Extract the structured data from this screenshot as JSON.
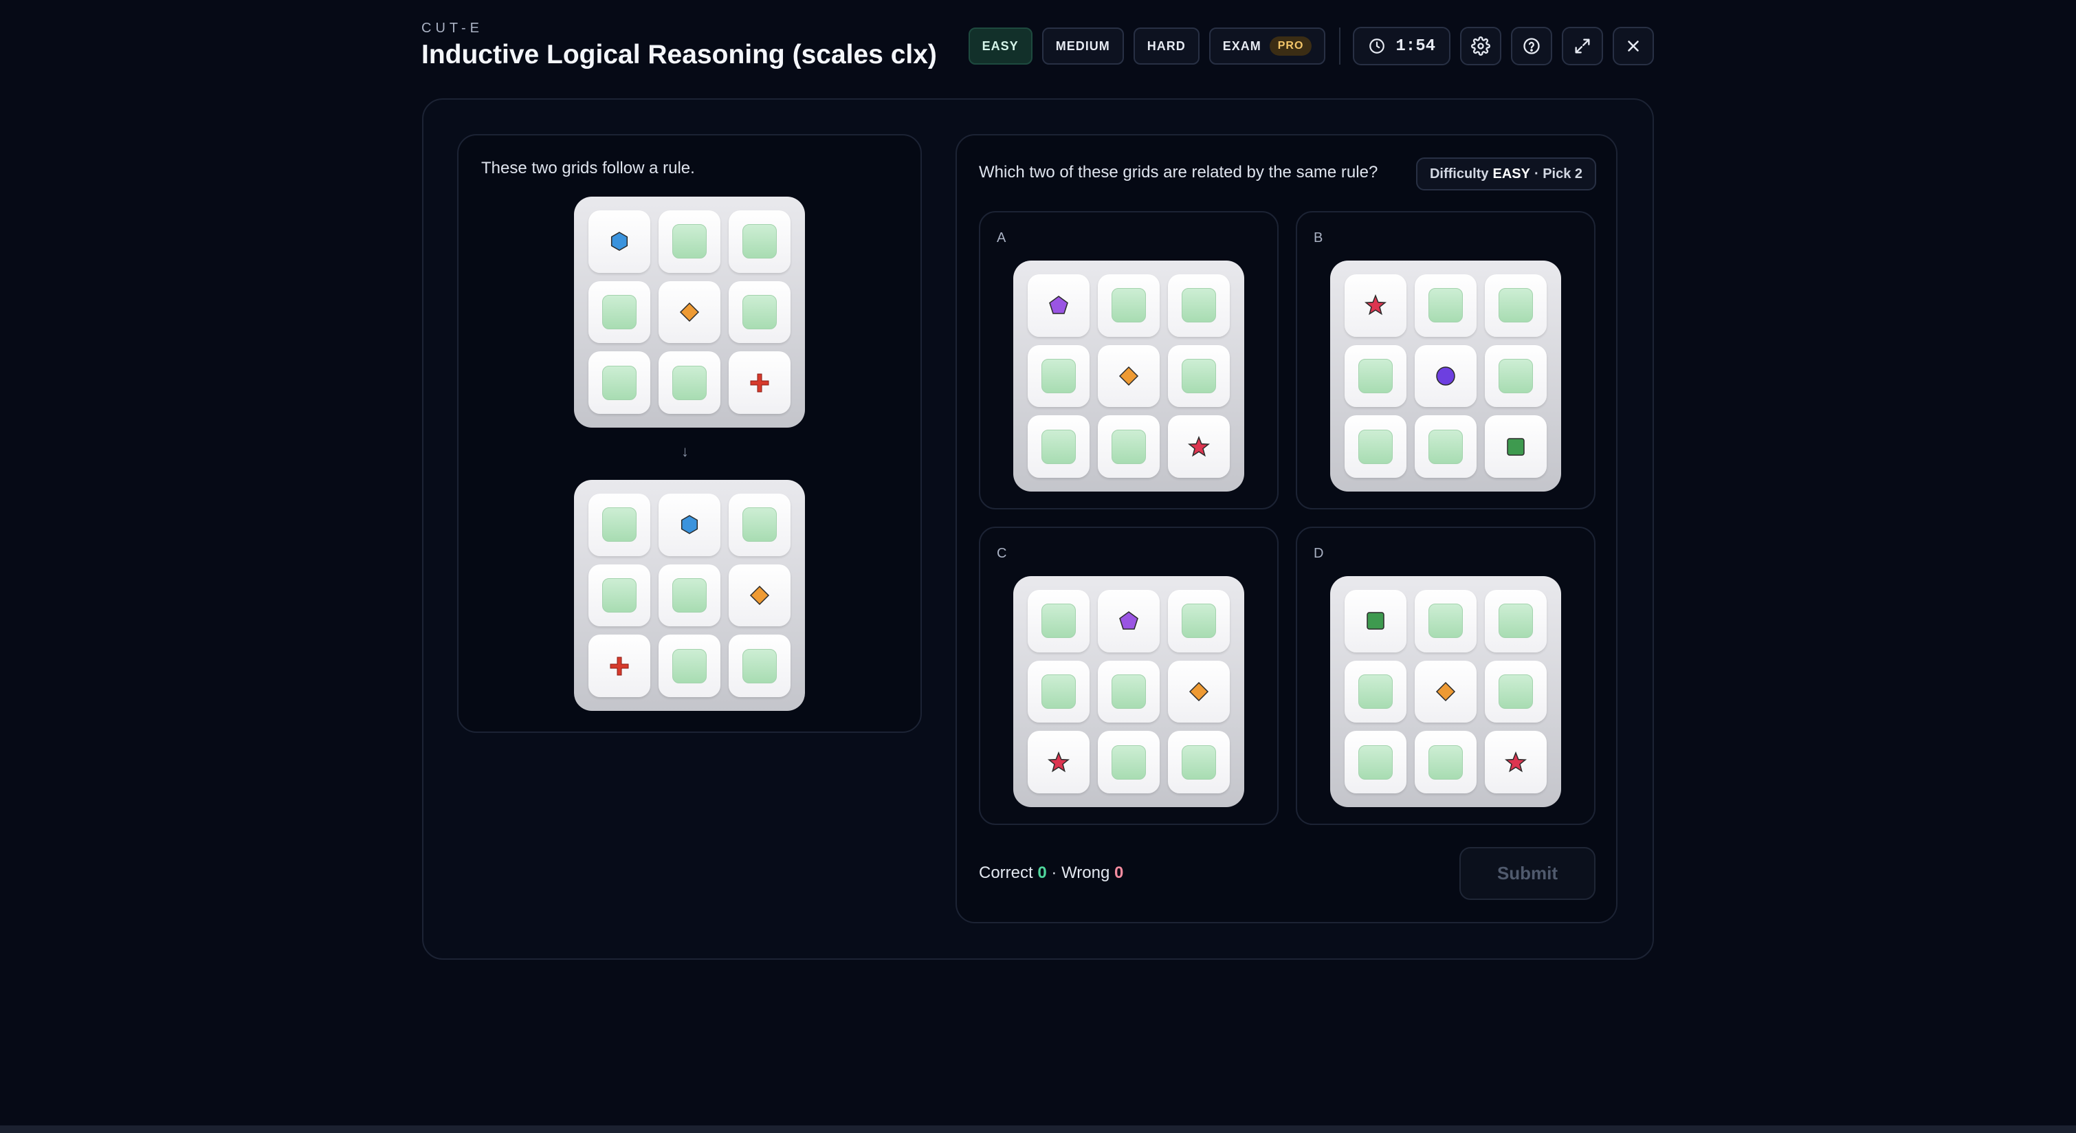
{
  "header": {
    "brand": "CUT-E",
    "title": "Inductive Logical Reasoning (scales clx)"
  },
  "difficulty_buttons": [
    {
      "label": "EASY",
      "active": true
    },
    {
      "label": "MEDIUM",
      "active": false
    },
    {
      "label": "HARD",
      "active": false
    },
    {
      "label": "EXAM",
      "active": false,
      "badge": "PRO"
    }
  ],
  "timer": {
    "value": "1:54",
    "icon": "clock-icon"
  },
  "toolbar_icons": [
    "gear-icon",
    "help-icon",
    "expand-icon",
    "close-icon"
  ],
  "left_panel": {
    "prompt": "These two grids follow a rule.",
    "arrow": "↓",
    "grid_before": [
      "hexagon",
      "blank",
      "blank",
      "blank",
      "diamond",
      "blank",
      "blank",
      "blank",
      "cross"
    ],
    "grid_after": [
      "blank",
      "hexagon",
      "blank",
      "blank",
      "blank",
      "diamond",
      "cross",
      "blank",
      "blank"
    ]
  },
  "right_panel": {
    "prompt": "Which two of these grids are related by the same rule?",
    "chip": {
      "prefix": "Difficulty",
      "level": "EASY",
      "suffix": "· Pick 2"
    },
    "options": [
      {
        "label": "A",
        "cells": [
          "pentagon",
          "blank",
          "blank",
          "blank",
          "diamond",
          "blank",
          "blank",
          "blank",
          "star"
        ]
      },
      {
        "label": "B",
        "cells": [
          "star",
          "blank",
          "blank",
          "blank",
          "circle",
          "blank",
          "blank",
          "blank",
          "square"
        ]
      },
      {
        "label": "C",
        "cells": [
          "blank",
          "pentagon",
          "blank",
          "blank",
          "blank",
          "diamond",
          "star",
          "blank",
          "blank"
        ]
      },
      {
        "label": "D",
        "cells": [
          "square",
          "blank",
          "blank",
          "blank",
          "diamond",
          "blank",
          "blank",
          "blank",
          "star"
        ]
      }
    ],
    "score": {
      "correct_label": "Correct",
      "correct": "0",
      "separator": "·",
      "wrong_label": "Wrong",
      "wrong": "0"
    },
    "submit_label": "Submit"
  },
  "colors": {
    "hexagon": "#3b93dd",
    "diamond": "#ee9a33",
    "cross": "#d63a2c",
    "pentagon": "#9a55e3",
    "star": "#dd3550",
    "circle": "#6d3fe0",
    "square": "#3e9a4f"
  }
}
